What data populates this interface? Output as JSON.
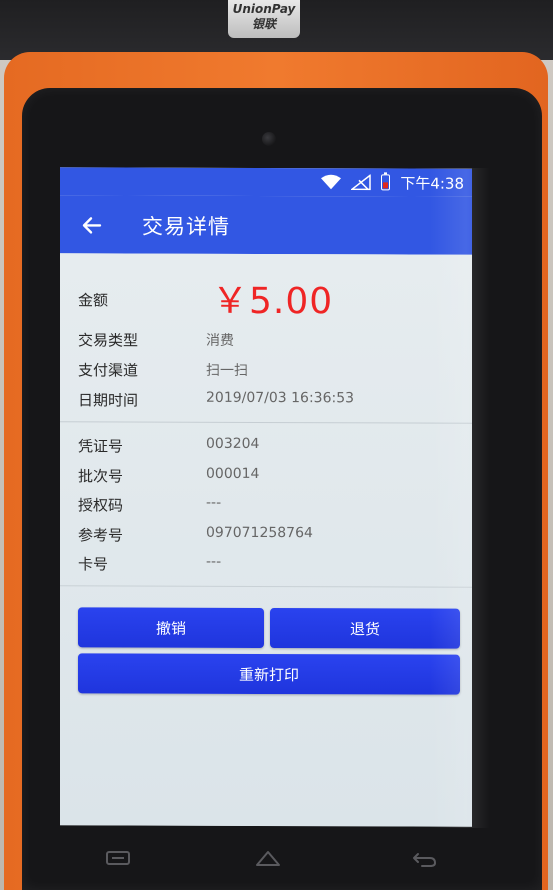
{
  "device": {
    "brand_badge_line1": "UnionPay",
    "brand_badge_line2": "银联"
  },
  "status_bar": {
    "time": "下午4:38",
    "icons": [
      "wifi-icon",
      "signal-off-icon",
      "battery-low-icon"
    ],
    "battery_color": "#e0261d"
  },
  "app_bar": {
    "title": "交易详情",
    "back_icon": "arrow-left-icon",
    "color": "#3257e3"
  },
  "transaction": {
    "amount_label": "金额",
    "amount_value": "￥5.00",
    "amount_color": "#ef2525",
    "type_label": "交易类型",
    "type_value": "消费",
    "channel_label": "支付渠道",
    "channel_value": "扫一扫",
    "datetime_label": "日期时间",
    "datetime_value": "2019/07/03 16:36:53",
    "voucher_label": "凭证号",
    "voucher_value": "003204",
    "batch_label": "批次号",
    "batch_value": "000014",
    "auth_label": "授权码",
    "auth_value": "---",
    "ref_label": "参考号",
    "ref_value": "097071258764",
    "card_label": "卡号",
    "card_value": "---"
  },
  "actions": {
    "cancel_label": "撤销",
    "refund_label": "退货",
    "reprint_label": "重新打印",
    "button_color": "#2a43ef"
  },
  "nav_bar": {
    "icons": [
      "menu-icon",
      "home-icon",
      "back-icon"
    ]
  }
}
